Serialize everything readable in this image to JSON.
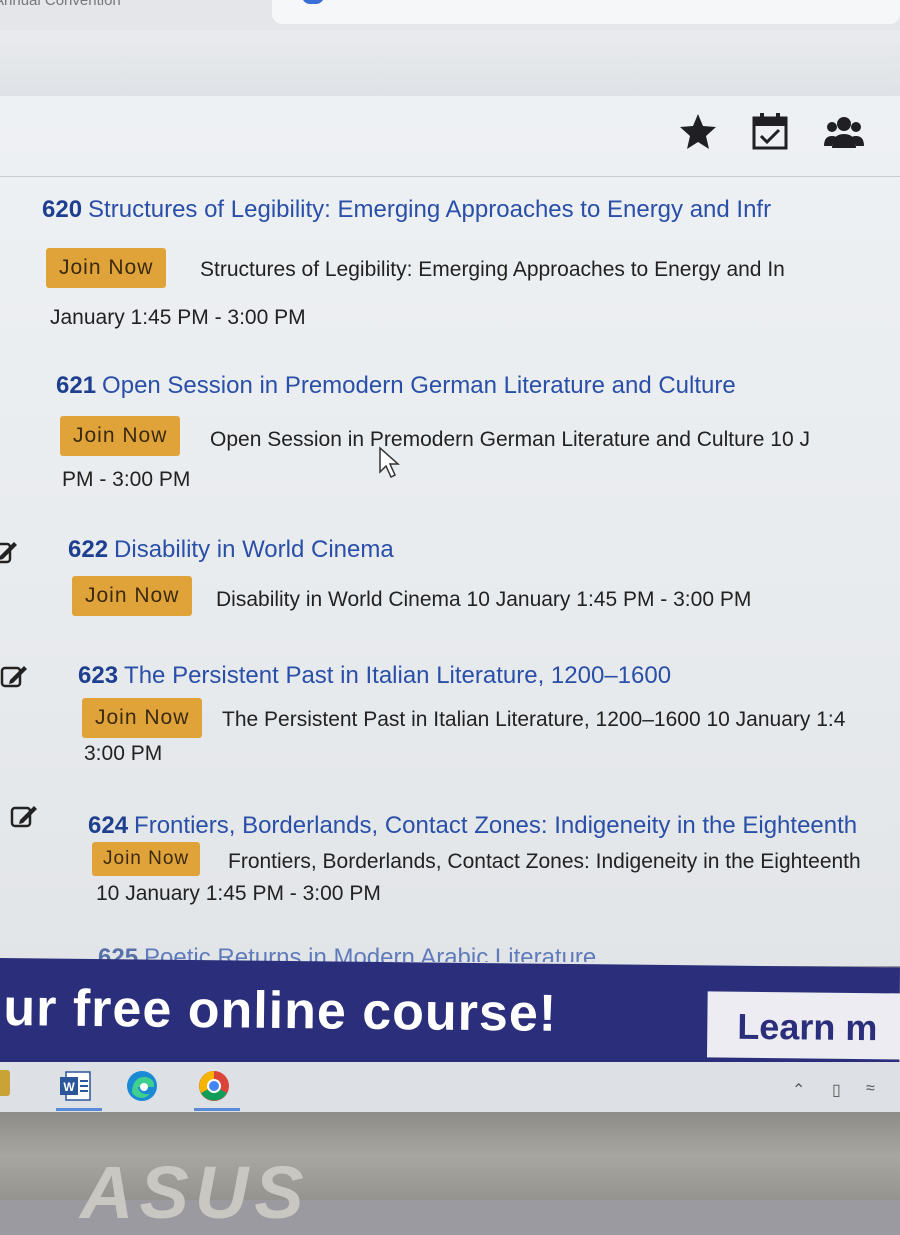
{
  "browser": {
    "tab_title": "Annual Convention"
  },
  "toolbar_icons": [
    "star-icon",
    "calendar-check-icon",
    "people-icon"
  ],
  "sessions": [
    {
      "number": "620",
      "title": "Structures of Legibility: Emerging Approaches to Energy and Infr",
      "join_label": "Join Now",
      "description": "Structures of Legibility: Emerging Approaches to Energy and In",
      "time": "January 1:45 PM - 3:00 PM"
    },
    {
      "number": "621",
      "title": "Open Session in Premodern German Literature and Culture",
      "join_label": "Join Now",
      "description": "Open Session in Premodern German Literature and Culture 10 J",
      "time": "PM - 3:00 PM"
    },
    {
      "number": "622",
      "title": "Disability in World Cinema",
      "join_label": "Join Now",
      "description": "Disability in World Cinema 10 January 1:45 PM - 3:00 PM",
      "time": ""
    },
    {
      "number": "623",
      "title": "The Persistent Past in Italian Literature, 1200–1600",
      "join_label": "Join Now",
      "description": "The Persistent Past in Italian Literature, 1200–1600 10 January 1:4",
      "time": "3:00 PM"
    },
    {
      "number": "624",
      "title": "Frontiers, Borderlands, Contact Zones: Indigeneity in the Eighteenth",
      "join_label": "Join Now",
      "description": "Frontiers, Borderlands, Contact Zones: Indigeneity in the Eighteenth",
      "time": "10 January 1:45 PM - 3:00 PM"
    },
    {
      "number": "625",
      "title": "Poetic Returns in Modern Arabic Literature"
    }
  ],
  "banner": {
    "text": "ur free online course!",
    "button_label": "Learn m"
  },
  "taskbar_icons": [
    "word-icon",
    "edge-icon",
    "chrome-icon"
  ],
  "laptop_logo": "ASUS"
}
